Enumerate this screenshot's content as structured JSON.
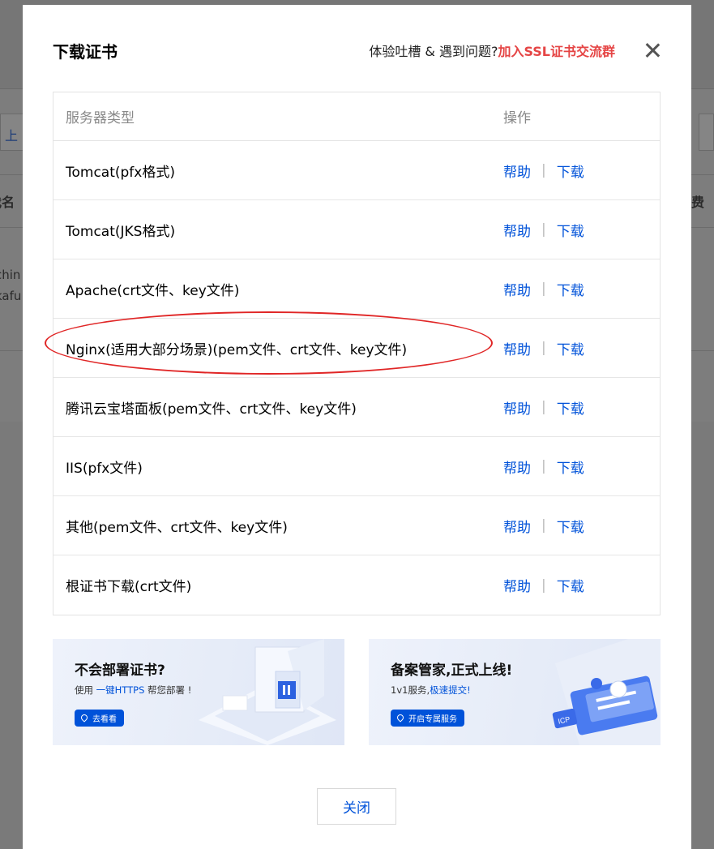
{
  "modal": {
    "title": "下载证书",
    "feedback_prefix": "体验吐槽 & 遇到问题?",
    "feedback_link": "加入SSL证书交流群",
    "close_label": "关闭"
  },
  "table": {
    "col_server": "服务器类型",
    "col_action": "操作",
    "help_label": "帮助",
    "separator": "|",
    "download_label": "下载",
    "rows": [
      {
        "name": "Tomcat(pfx格式)"
      },
      {
        "name": "Tomcat(JKS格式)"
      },
      {
        "name": "Apache(crt文件、key文件)"
      },
      {
        "name": "Nginx(适用大部分场景)(pem文件、crt文件、key文件)"
      },
      {
        "name": "腾讯云宝塔面板(pem文件、crt文件、key文件)"
      },
      {
        "name": "IIS(pfx文件)"
      },
      {
        "name": "其他(pem文件、crt文件、key文件)"
      },
      {
        "name": "根证书下载(crt文件)"
      }
    ]
  },
  "banners": [
    {
      "title": "不会部署证书?",
      "sub_prefix": "使用 ",
      "sub_link": "一键HTTPS",
      "sub_suffix": " 帮您部署 !",
      "button": "去看看"
    },
    {
      "title": "备案管家,正式上线!",
      "sub_prefix": "1v1服务,",
      "sub_link": "极速提交!",
      "sub_suffix": "",
      "button": "开启专属服务",
      "badge": "ICP"
    }
  ],
  "background": {
    "frag1": "上",
    "frag2": "我名",
    "frag3": "费",
    "frag4": "chin",
    "frag5": "kafu"
  },
  "colors": {
    "accent": "#0052d9",
    "highlight_red": "#e54545",
    "annotation_red": "#e02626"
  }
}
